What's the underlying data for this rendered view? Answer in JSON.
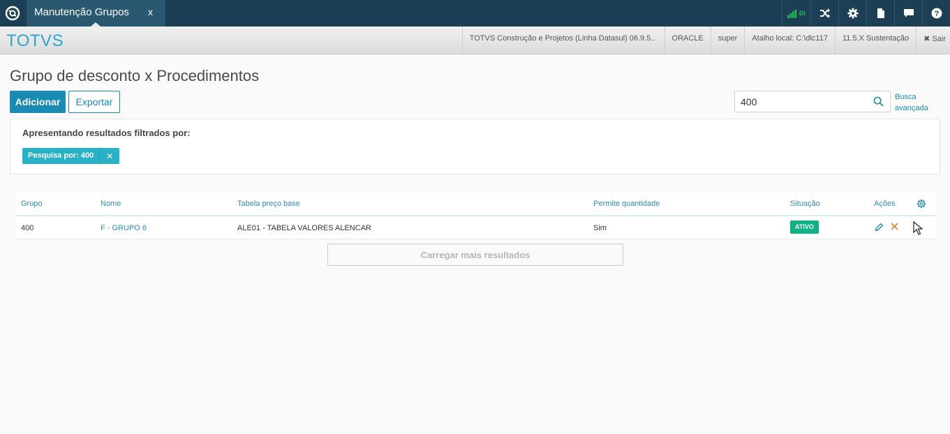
{
  "topbar": {
    "tab_label": "Manutenção Grupos D",
    "tab_close": "x",
    "signal_label": "DI"
  },
  "header": {
    "brand": "TOTVS",
    "info_items": [
      "TOTVS Construção e Projetos (Linha Datasul) 06.9.5...",
      "ORACLE",
      "super",
      "Atalho local: C:\\dlc117",
      "11.5.X Sustentação"
    ],
    "logout_label": "Sair"
  },
  "page": {
    "title": "Grupo de desconto x Procedimentos",
    "add_label": "Adicionar",
    "export_label": "Exportar"
  },
  "search": {
    "value": "400",
    "advanced_line1": "Busca",
    "advanced_line2": "avançada"
  },
  "filter": {
    "title": "Apresentando resultados filtrados por:",
    "chip_label": "Pesquisa por: 400",
    "chip_close": "✕"
  },
  "table": {
    "headers": {
      "grupo": "Grupo",
      "nome": "Nome",
      "tabela": "Tabela preço base",
      "permite": "Permite quantidade",
      "situacao": "Situação",
      "acoes": "Ações"
    },
    "rows": [
      {
        "grupo": "400",
        "nome": "F - GRUPO 6",
        "tabela": "ALE01 - TABELA VALORES ALENCAR",
        "permite": "Sim",
        "situacao": "ATIVO"
      }
    ]
  },
  "load_more_label": "Carregar mais resultados",
  "colors": {
    "topbar": "#1c3f55",
    "accent": "#1a8bb3",
    "brand": "#2ba6cb",
    "chip": "#29b1c7",
    "status_active": "#12b085"
  }
}
